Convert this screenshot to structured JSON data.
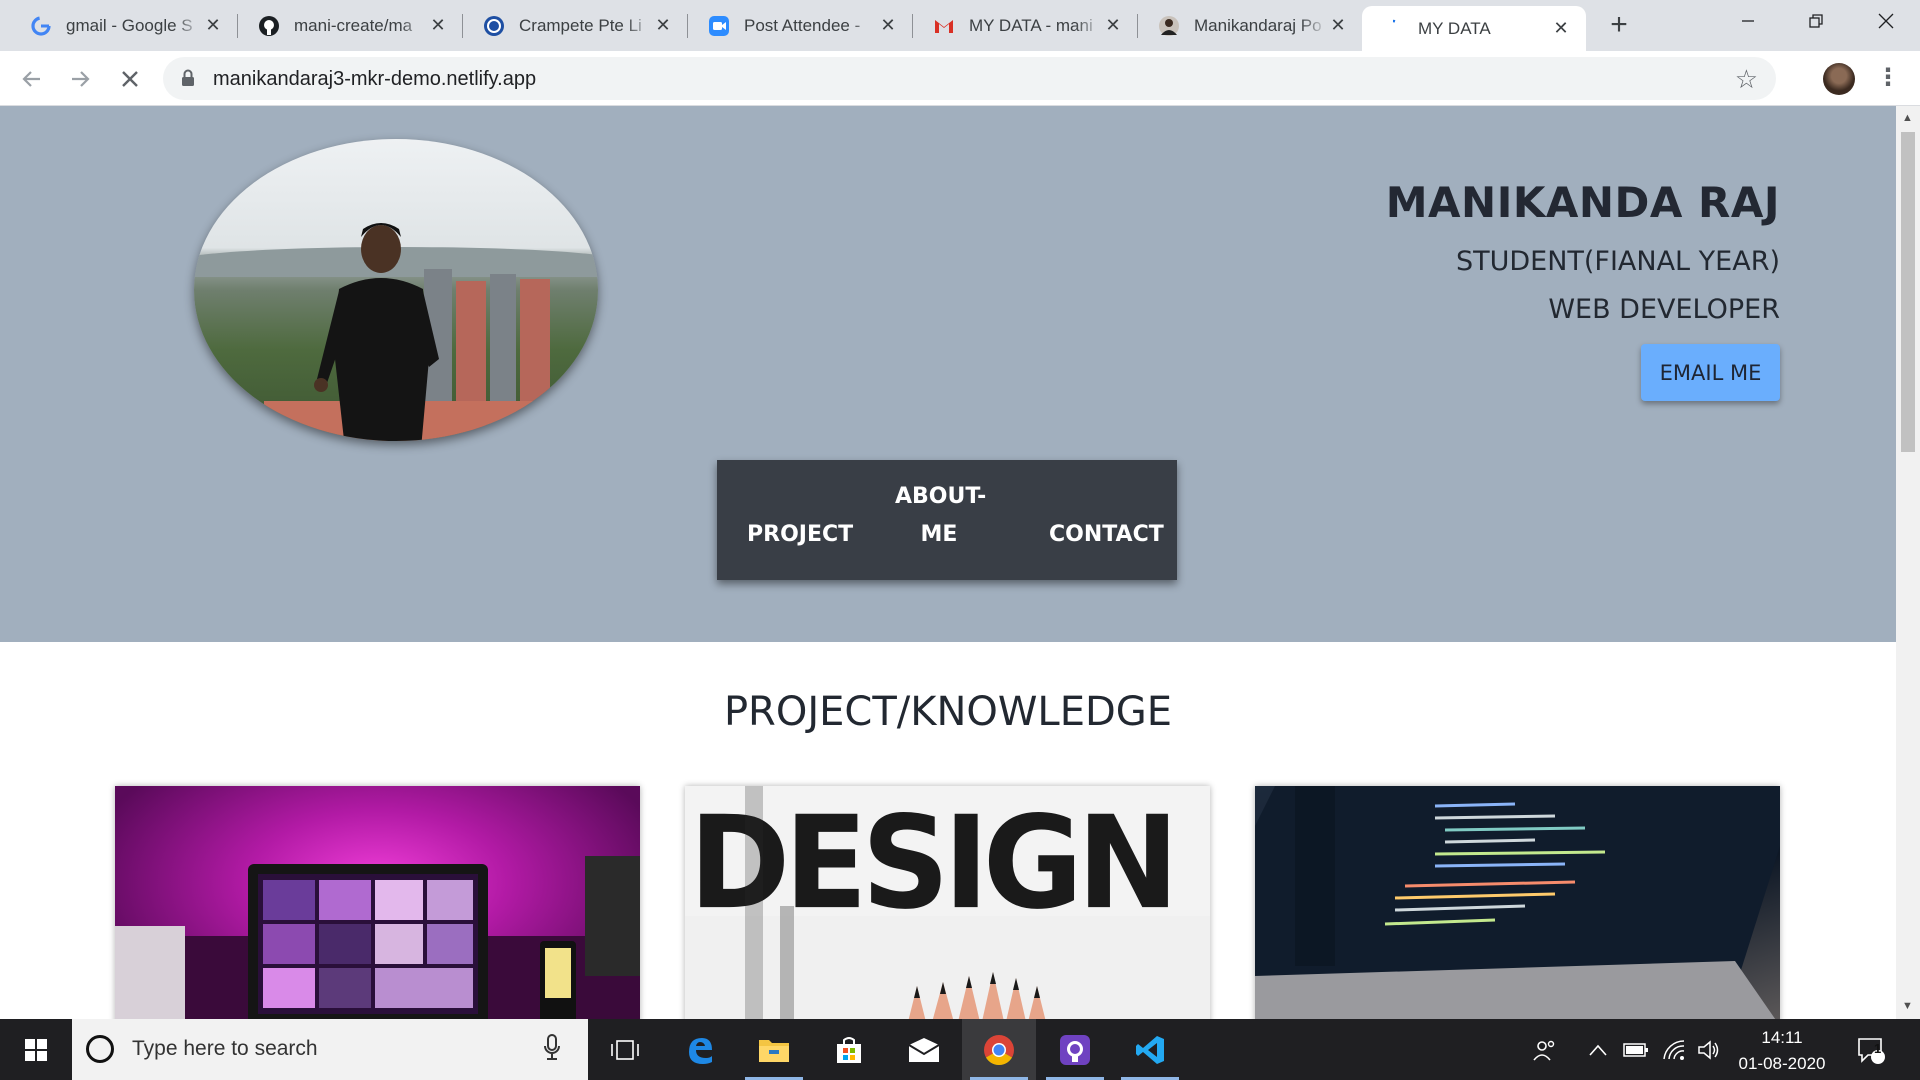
{
  "browser": {
    "tabs": [
      {
        "title": "gmail - Google S",
        "icon": "google-icon"
      },
      {
        "title": "mani-create/ma",
        "icon": "github-icon"
      },
      {
        "title": "Crampete Pte Li",
        "icon": "crampete-icon"
      },
      {
        "title": "Post Attendee -",
        "icon": "zoom-icon"
      },
      {
        "title": "MY DATA - mani",
        "icon": "gmail-icon"
      },
      {
        "title": "Manikandaraj Po",
        "icon": "profile-icon"
      },
      {
        "title": "MY DATA",
        "icon": "loading-icon",
        "active": true
      }
    ],
    "url": "manikandaraj3-mkr-demo.netlify.app"
  },
  "hero": {
    "name": "MANIKANDA RAJ",
    "role_1": "STUDENT(FIANAL YEAR)",
    "role_2": "WEB DEVELOPER",
    "email_button": "EMAIL ME"
  },
  "nav": {
    "project": "PROJECT",
    "about_line1": "ABOUT-",
    "about_line2": "ME",
    "contact": "CONTACT"
  },
  "section": {
    "title": "PROJECT/KNOWLEDGE",
    "cards": [
      {
        "image": "laptop-pink-photo"
      },
      {
        "image": "design-pencils-photo",
        "text": "DESIGN"
      },
      {
        "image": "laptop-code-photo"
      }
    ]
  },
  "taskbar": {
    "search_placeholder": "Type here to search",
    "time": "14:11",
    "date": "01-08-2020",
    "notification_count": "1"
  },
  "colors": {
    "hero_bg": "#a1afbe",
    "nav_bg": "#393e46",
    "email_button_bg": "#6aaefd",
    "text_dark": "#222831"
  }
}
